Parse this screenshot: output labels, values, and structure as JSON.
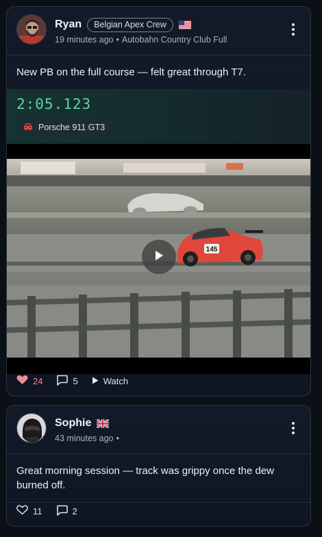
{
  "posts": [
    {
      "author": "Ryan",
      "crew": "Belgian Apex Crew",
      "flag_icon": "us-flag-icon",
      "time": "19 minutes ago",
      "location": "Autobahn Country Club Full",
      "text": "New PB on the full course — felt great through T7.",
      "lap_time": "2:05.123",
      "car": "Porsche 911 GT3",
      "car_number": "145",
      "likes": "24",
      "comments": "5",
      "watch_label": "Watch",
      "liked": true
    },
    {
      "author": "Sophie",
      "flag_icon": "uk-flag-icon",
      "time": "43 minutes ago",
      "text": "Great morning session — track was grippy once the dew burned off.",
      "likes": "11",
      "comments": "2"
    }
  ],
  "colors": {
    "lap_time": "#5fd3a0",
    "like_active": "#ef8b94",
    "car_chip_icon": "#e0444d",
    "card_bg": "#121a28",
    "card_border": "#2b3442"
  }
}
